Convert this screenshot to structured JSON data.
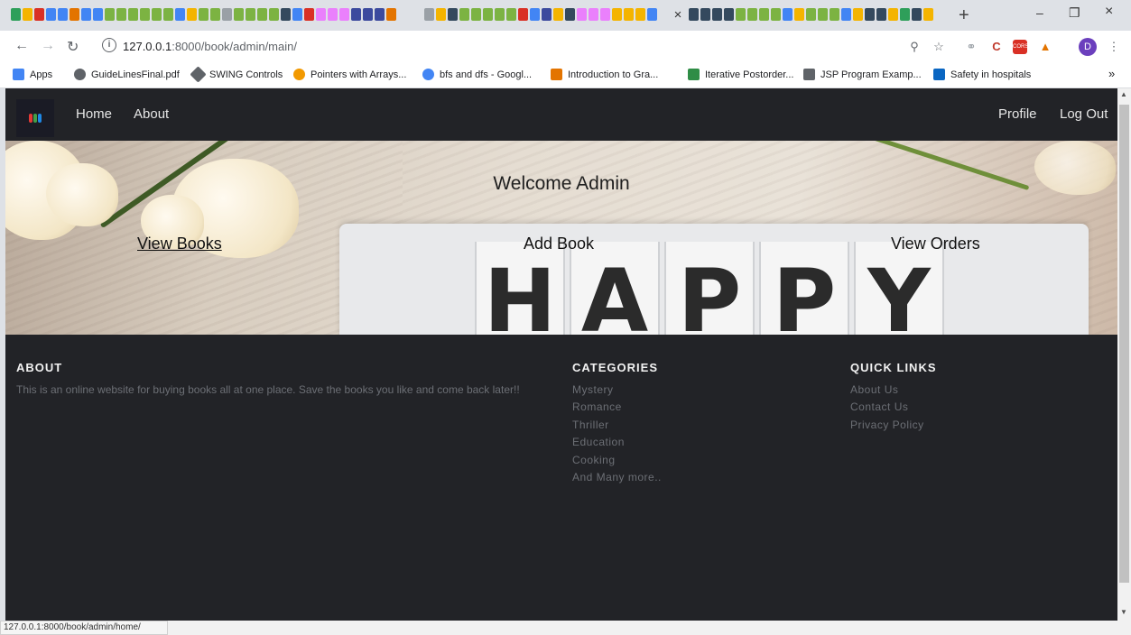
{
  "browser": {
    "active_tab_close": "×",
    "new_tab": "+",
    "window_controls": {
      "minimize": "–",
      "restore": "❐",
      "close": "×"
    },
    "url_host": "127.0.0.1",
    "url_rest": ":8000/book/admin/main/",
    "avatar_letter": "D",
    "bookmarks": [
      {
        "label": "Apps",
        "color": "#4285f4"
      },
      {
        "label": "GuideLinesFinal.pdf",
        "color": "#5f6368"
      },
      {
        "label": "SWING Controls",
        "color": "#5f6368"
      },
      {
        "label": "Pointers with Arrays...",
        "color": "#f29900"
      },
      {
        "label": "bfs and dfs - Googl...",
        "color": "#4285f4"
      },
      {
        "label": "Introduction to Gra...",
        "color": "#e37400"
      },
      {
        "label": "Iterative Postorder...",
        "color": "#2f8d46"
      },
      {
        "label": "JSP Program Examp...",
        "color": "#5f6368"
      },
      {
        "label": "Safety in hospitals",
        "color": "#0a66c2"
      }
    ],
    "bookmarks_more": "»",
    "status_url": "127.0.0.1:8000/book/admin/home/"
  },
  "site": {
    "nav": {
      "home": "Home",
      "about": "About",
      "profile": "Profile",
      "logout": "Log Out"
    },
    "hero": {
      "welcome": "Welcome Admin",
      "view_books": "View Books",
      "add_book": "Add Book",
      "view_orders": "View Orders",
      "letterboard": [
        "H",
        "A",
        "P",
        "P",
        "Y"
      ]
    },
    "footer": {
      "about_title": "ABOUT",
      "about_text": "This is an online website for buying books all at one place. Save the books you like and come back later!!",
      "categories_title": "CATEGORIES",
      "categories": [
        "Mystery",
        "Romance",
        "Thriller",
        "Education",
        "Cooking",
        "And Many more.."
      ],
      "quick_links_title": "QUICK LINKS",
      "quick_links": [
        "About Us",
        "Contact Us",
        "Privacy Policy"
      ]
    }
  },
  "colors": {
    "nav_bg": "#222327",
    "footer_text": "#6c6f75",
    "heading": "#f2f2f2"
  }
}
